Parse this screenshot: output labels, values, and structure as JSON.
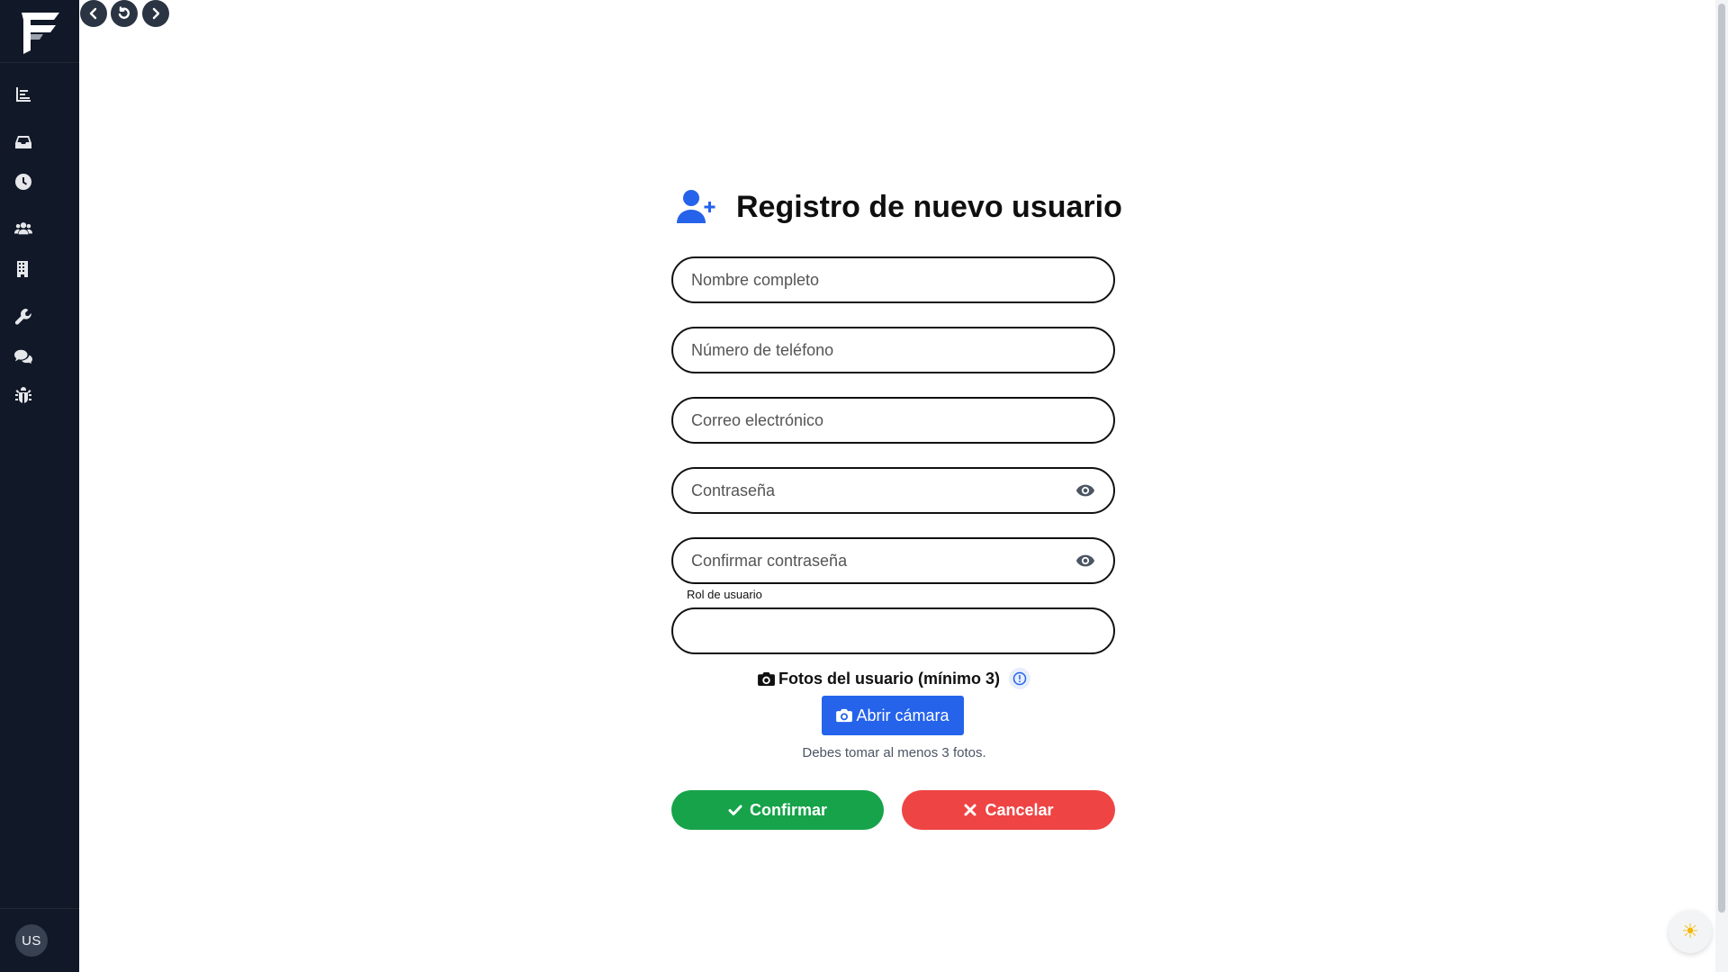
{
  "sidebar": {
    "logo_icon": "brand-logo-icon",
    "items": [
      {
        "icon": "chart-bar-icon",
        "label": ""
      },
      {
        "icon": "inbox-icon",
        "label": ""
      },
      {
        "icon": "clock-icon",
        "label": ""
      },
      {
        "icon": "users-icon",
        "label": ""
      },
      {
        "icon": "building-icon",
        "label": ""
      },
      {
        "icon": "wrench-icon",
        "label": ""
      },
      {
        "icon": "comments-icon",
        "label": ""
      },
      {
        "icon": "bug-icon",
        "label": ""
      }
    ],
    "avatar_initials": "US"
  },
  "topnav": {
    "icons": [
      "chevron-left-icon",
      "refresh-icon",
      "chevron-right-icon"
    ]
  },
  "form": {
    "title": "Registro de nuevo usuario",
    "title_icon": "user-plus-icon",
    "fields": {
      "name_placeholder": "Nombre completo",
      "phone_placeholder": "Número de teléfono",
      "email_placeholder": "Correo electrónico",
      "password_placeholder": "Contraseña",
      "confirm_password_placeholder": "Confirmar contraseña",
      "role_label": "Rol de usuario",
      "role_value": ""
    },
    "photos": {
      "label": "Fotos del usuario (mínimo 3)",
      "camera_button": "Abrir cámara",
      "hint": "Debes tomar al menos 3 fotos."
    },
    "actions": {
      "confirm": "Confirmar",
      "cancel": "Cancelar"
    }
  },
  "colors": {
    "sidebar_bg": "#111827",
    "accent_blue": "#2563eb",
    "confirm_green": "#16a34a",
    "cancel_red": "#ef4444"
  },
  "theme_toggle_icon": "sun-icon"
}
